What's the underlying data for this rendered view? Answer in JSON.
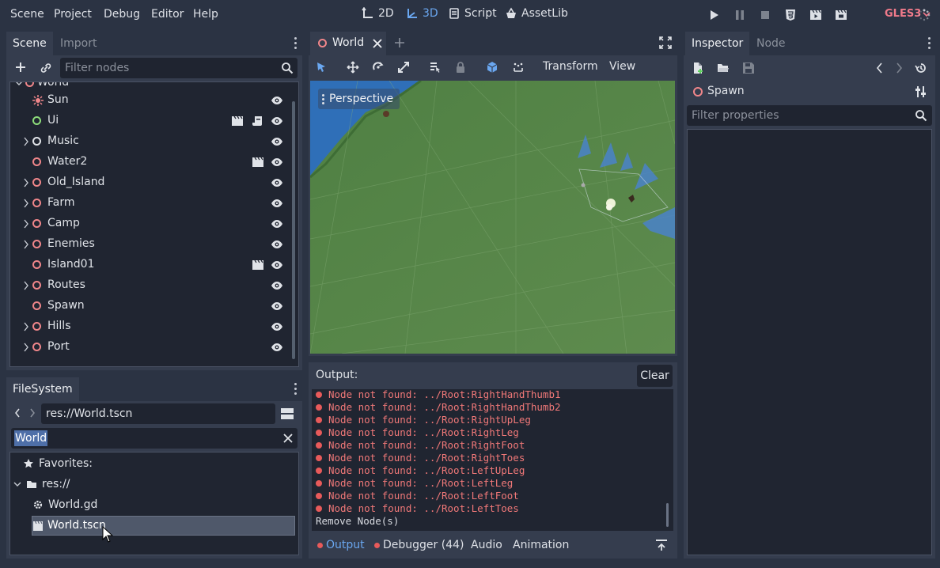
{
  "menu": [
    "Scene",
    "Project",
    "Debug",
    "Editor",
    "Help"
  ],
  "modes": {
    "m2d": "2D",
    "m3d": "3D",
    "script": "Script",
    "assetlib": "AssetLib"
  },
  "renderer": "GLES3",
  "scene_dock": {
    "tabs": [
      "Scene",
      "Import"
    ],
    "filter_placeholder": "Filter nodes",
    "cut_off_top_label": "World",
    "nodes": [
      {
        "label": "Sun",
        "icon": "sun-icon",
        "expandable": false
      },
      {
        "label": "Ui",
        "icon": "control-node-icon",
        "expandable": false,
        "scene_instance": true,
        "script": true
      },
      {
        "label": "Music",
        "icon": "node-icon",
        "expandable": true
      },
      {
        "label": "Water2",
        "icon": "spatial-node-icon",
        "expandable": false,
        "scene_instance": true
      },
      {
        "label": "Old_Island",
        "icon": "spatial-node-icon",
        "expandable": true
      },
      {
        "label": "Farm",
        "icon": "spatial-node-icon",
        "expandable": true
      },
      {
        "label": "Camp",
        "icon": "spatial-node-icon",
        "expandable": true
      },
      {
        "label": "Enemies",
        "icon": "spatial-node-icon",
        "expandable": true
      },
      {
        "label": "Island01",
        "icon": "spatial-node-icon",
        "expandable": false,
        "scene_instance": true
      },
      {
        "label": "Routes",
        "icon": "spatial-node-icon",
        "expandable": true
      },
      {
        "label": "Spawn",
        "icon": "spatial-node-icon",
        "expandable": false
      },
      {
        "label": "Hills",
        "icon": "spatial-node-icon",
        "expandable": true
      },
      {
        "label": "Port",
        "icon": "spatial-node-icon",
        "expandable": true
      }
    ]
  },
  "filesystem": {
    "tab": "FileSystem",
    "path": "res://World.tscn",
    "search_value": "World",
    "favorites_label": "Favorites:",
    "root_label": "res://",
    "files": [
      {
        "label": "World.gd",
        "icon": "gear-script-icon"
      },
      {
        "label": "World.tscn",
        "icon": "scene-file-icon",
        "selected": true
      }
    ]
  },
  "editor_tab": {
    "label": "World"
  },
  "viewport_toolbar": {
    "transform": "Transform",
    "view": "View"
  },
  "viewport": {
    "perspective_label": "Perspective"
  },
  "output": {
    "title": "Output:",
    "clear_label": "Clear",
    "lines": [
      "Node not found: ../Root:RightHandThumb1",
      "Node not found: ../Root:RightHandThumb2",
      "Node not found: ../Root:RightUpLeg",
      "Node not found: ../Root:RightLeg",
      "Node not found: ../Root:RightFoot",
      "Node not found: ../Root:RightToes",
      "Node not found: ../Root:LeftUpLeg",
      "Node not found: ../Root:LeftLeg",
      "Node not found: ../Root:LeftFoot",
      "Node not found: ../Root:LeftToes"
    ],
    "last_line": "Remove Node(s)"
  },
  "bottom_tabs": {
    "output": "Output",
    "debugger": "Debugger (44)",
    "audio": "Audio",
    "animation": "Animation"
  },
  "inspector": {
    "tabs": [
      "Inspector",
      "Node"
    ],
    "selected_node": "Spawn",
    "filter_placeholder": "Filter properties"
  },
  "colors": {
    "accent": "#6aa7f0",
    "spatial_node": "#f0868a",
    "error": "#f07878",
    "renderer": "#f07a8a"
  }
}
